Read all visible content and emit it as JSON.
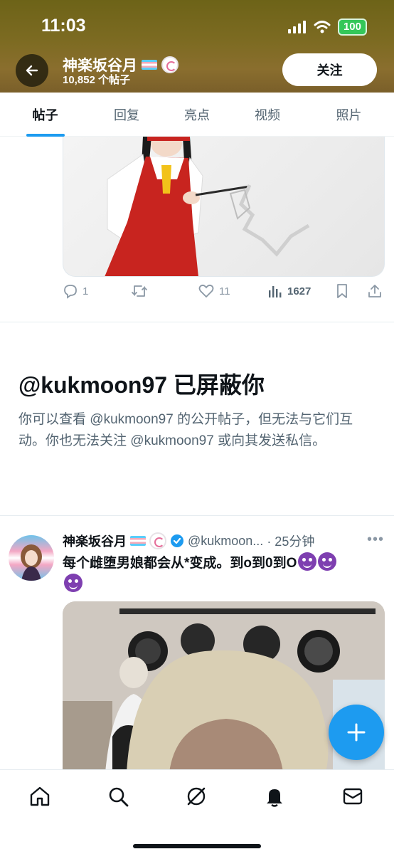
{
  "status_bar": {
    "time": "11:03",
    "battery": "100"
  },
  "header": {
    "name": "神楽坂谷月",
    "post_count": "10,852 个帖子",
    "follow_label": "关注"
  },
  "tabs": [
    {
      "label": "帖子",
      "active": true
    },
    {
      "label": "回复",
      "active": false
    },
    {
      "label": "亮点",
      "active": false
    },
    {
      "label": "视频",
      "active": false
    },
    {
      "label": "照片",
      "active": false
    }
  ],
  "prev_post": {
    "replies": "1",
    "retweets": "",
    "likes": "11",
    "views": "1627"
  },
  "blocked": {
    "title": "@kukmoon97 已屏蔽你",
    "text": "你可以查看 @kukmoon97 的公开帖子，但无法与它们互动。你也无法关注 @kukmoon97 或向其发送私信。"
  },
  "post": {
    "name": "神楽坂谷月",
    "handle": "@kukmoon...",
    "time": "· 25分钟",
    "text": "每个雌堕男娘都会从*变成。到o到0到O"
  },
  "colors": {
    "accent": "#1d9bf0",
    "header_bg": "#7d6b22"
  },
  "bottom_nav": [
    "home-icon",
    "search-icon",
    "grok-icon",
    "notifications-icon",
    "messages-icon"
  ]
}
